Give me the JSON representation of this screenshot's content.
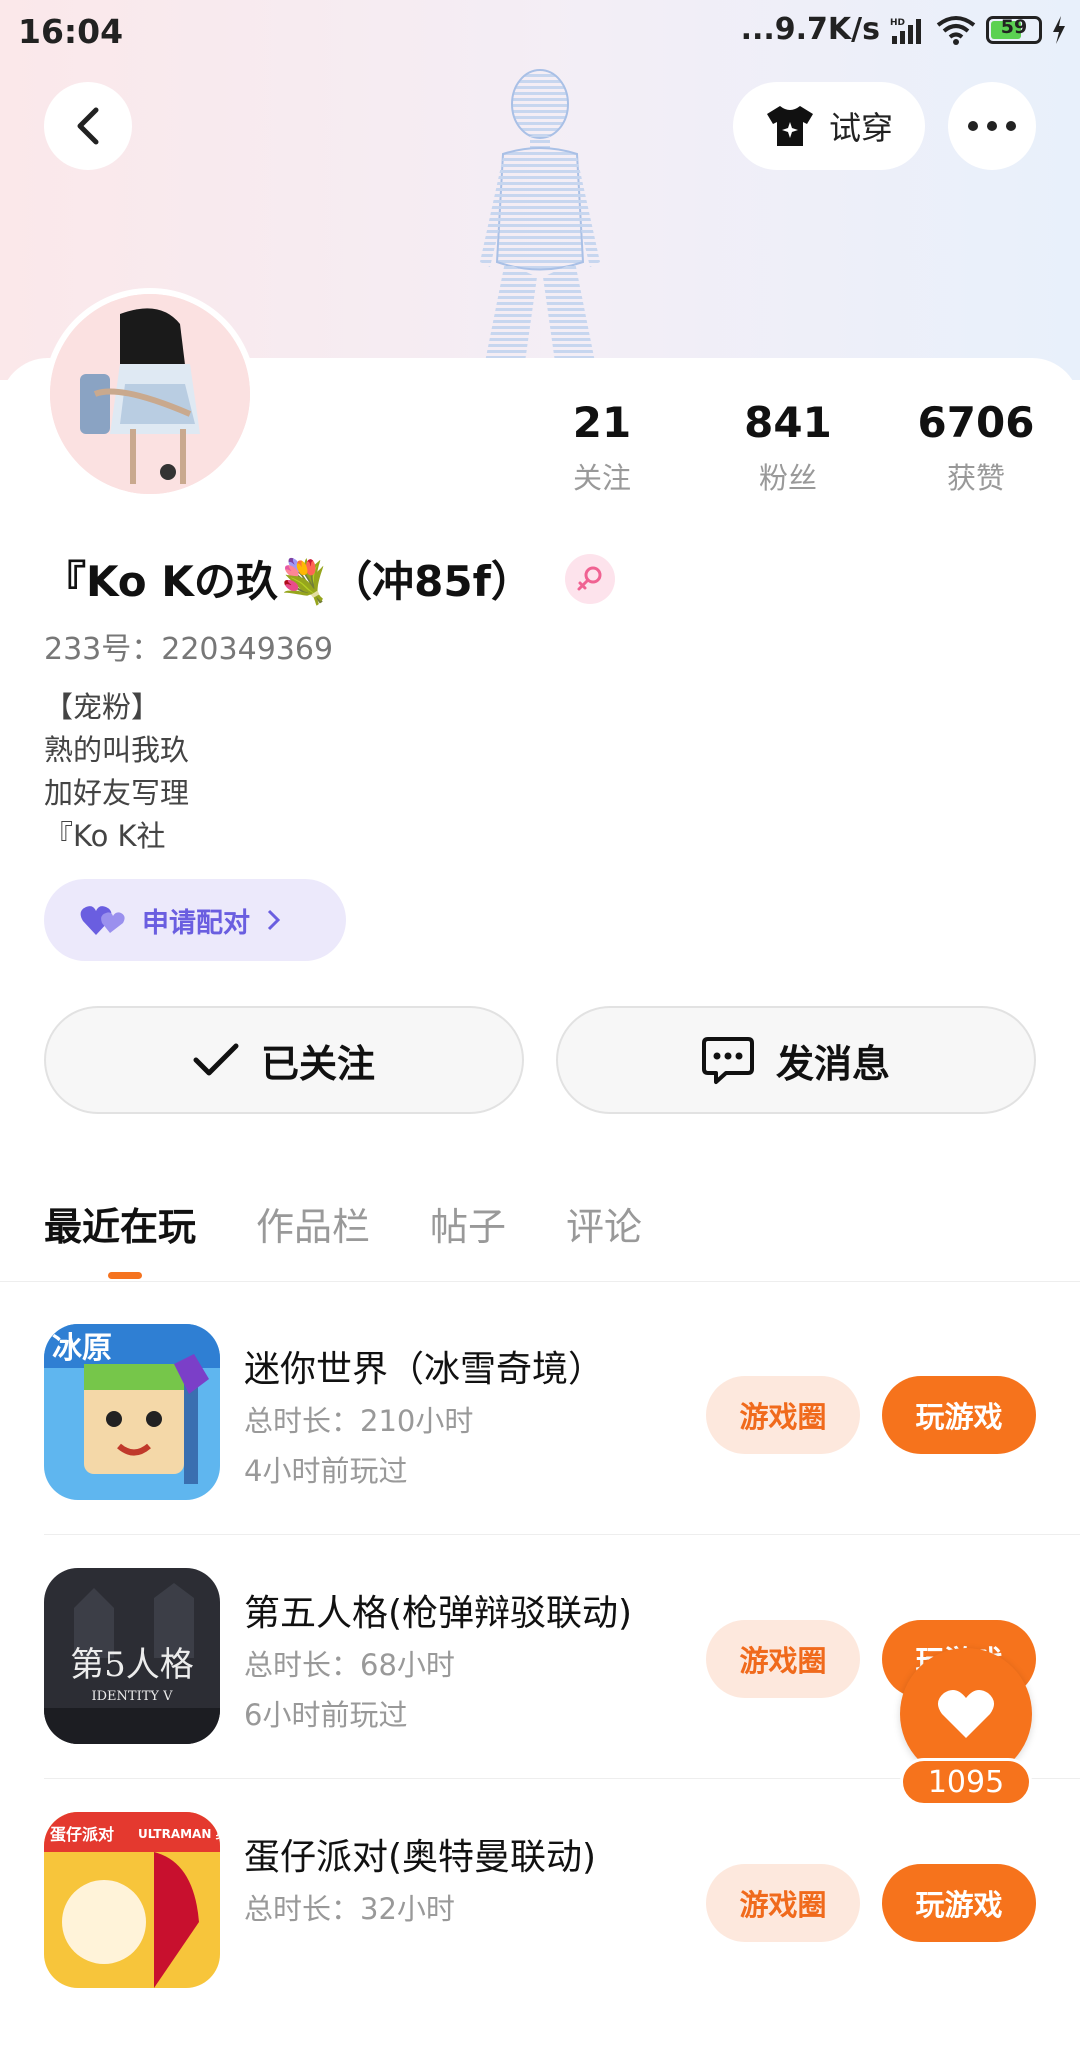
{
  "status_bar": {
    "time": "16:04",
    "network_speed": "...9.7K/s",
    "battery": "59"
  },
  "header": {
    "back_icon": "back-arrow-icon",
    "try_on_label": "试穿",
    "more_icon": "more-dots-icon"
  },
  "profile": {
    "stats": [
      {
        "value": "21",
        "label": "关注"
      },
      {
        "value": "841",
        "label": "粉丝"
      },
      {
        "value": "6706",
        "label": "获赞"
      }
    ],
    "nickname": "『Ko Kの玖💐（冲85f）",
    "gender_icon": "female-icon",
    "user_id": "233号：220349369",
    "bio": [
      "【宠粉】",
      "熟的叫我玖",
      "加好友写理",
      "『Ko K社"
    ],
    "pair_label": "申请配对",
    "follow_label": "已关注",
    "message_label": "发消息"
  },
  "tabs": [
    "最近在玩",
    "作品栏",
    "帖子",
    "评论"
  ],
  "games": [
    {
      "title": "迷你世界（冰雪奇境）",
      "total": "总时长：210小时",
      "last_played": "4小时前玩过",
      "circle_label": "游戏圈",
      "play_label": "玩游戏"
    },
    {
      "title": "第五人格(枪弹辩驳联动)",
      "total": "总时长：68小时",
      "last_played": "6小时前玩过",
      "circle_label": "游戏圈",
      "play_label": "玩游戏"
    },
    {
      "title": "蛋仔派对(奥特曼联动)",
      "total": "总时长：32小时",
      "last_played": "",
      "circle_label": "游戏圈",
      "play_label": "玩游戏"
    }
  ],
  "game_icon_texts": {
    "game1": "冰原",
    "game2": "第5人格",
    "game2_sub": "IDENTITY V",
    "game3": "蛋仔派对",
    "game3_brand": "ULTRAMAN 奥特曼"
  },
  "like_button": {
    "count": "1095"
  },
  "colors": {
    "accent": "#f6731c",
    "accent_light": "#fde8dd",
    "pair_bg": "#ece9fb",
    "pair_text": "#6a5ee0"
  }
}
